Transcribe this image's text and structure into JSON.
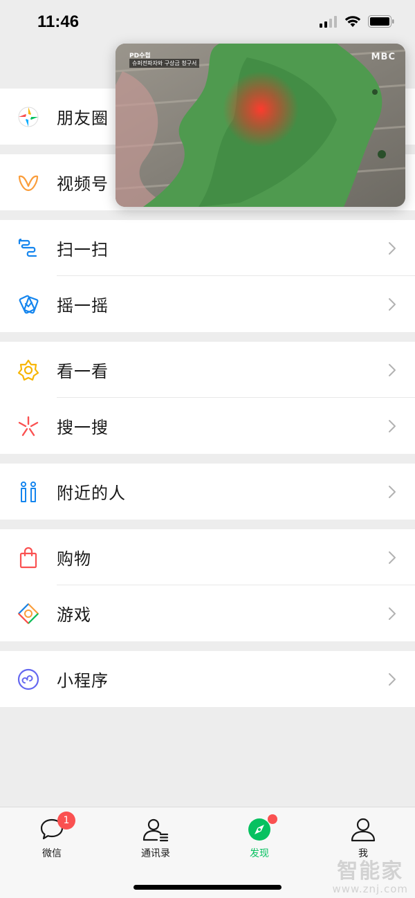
{
  "status_bar": {
    "time": "11:46"
  },
  "video": {
    "badge": "PD수첩",
    "caption": "슈퍼전파자와 구상금 청구서",
    "logo": "MBC"
  },
  "groups": [
    {
      "items": [
        {
          "label": "朋友圈",
          "icon": "moments-icon"
        }
      ]
    },
    {
      "items": [
        {
          "label": "视频号",
          "icon": "channels-icon"
        }
      ]
    },
    {
      "items": [
        {
          "label": "扫一扫",
          "icon": "scan-icon"
        },
        {
          "label": "摇一摇",
          "icon": "shake-icon"
        }
      ]
    },
    {
      "items": [
        {
          "label": "看一看",
          "icon": "top-stories-icon"
        },
        {
          "label": "搜一搜",
          "icon": "search-icon"
        }
      ]
    },
    {
      "items": [
        {
          "label": "附近的人",
          "icon": "people-nearby-icon"
        }
      ]
    },
    {
      "items": [
        {
          "label": "购物",
          "icon": "shopping-bag-icon"
        },
        {
          "label": "游戏",
          "icon": "games-icon"
        }
      ]
    },
    {
      "items": [
        {
          "label": "小程序",
          "icon": "mini-programs-icon"
        }
      ]
    }
  ],
  "tabbar": {
    "tabs": [
      {
        "label": "微信",
        "badge": "1"
      },
      {
        "label": "通讯录"
      },
      {
        "label": "发现"
      },
      {
        "label": "我"
      }
    ]
  },
  "watermark": {
    "title": "智能家",
    "url": "www.znj.com"
  },
  "colors": {
    "accent": "#07c160",
    "badge": "#fa5151",
    "background": "#ededed"
  }
}
